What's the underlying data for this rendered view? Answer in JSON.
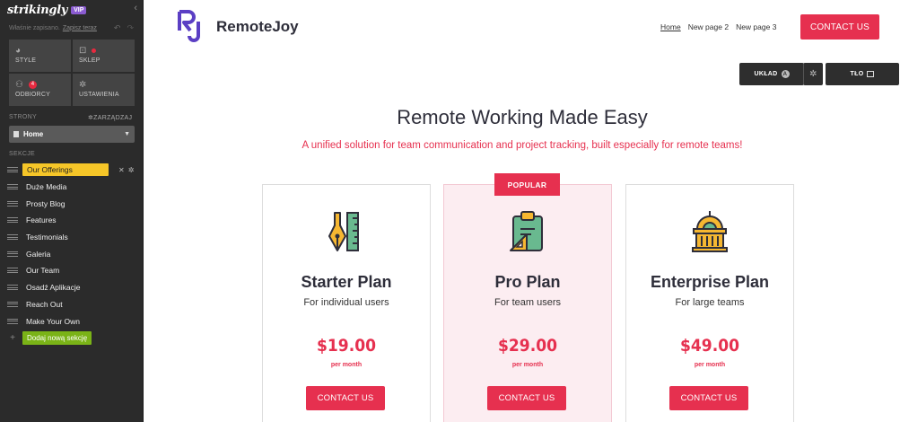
{
  "sidebar": {
    "brand": "strikingly",
    "vip": "VIP",
    "saved_text": "Właśnie zapisano.",
    "save_now": "Zapisz teraz",
    "tiles": [
      {
        "label": "STYLE",
        "icon": "palette-icon"
      },
      {
        "label": "SKLEP",
        "icon": "shopping-bag-icon"
      },
      {
        "label": "ODBIORCY",
        "icon": "users-icon",
        "badge": "4"
      },
      {
        "label": "USTAWIENIA",
        "icon": "gear-icon"
      }
    ],
    "pages_label": "STRONY",
    "manage_label": "ZARZĄDZAJ",
    "current_page": "Home",
    "sections_label": "SEKCJE",
    "sections": [
      "Our Offerings",
      "Duże Media",
      "Prosty Blog",
      "Features",
      "Testimonials",
      "Galeria",
      "Our Team",
      "Osadź Aplikacje",
      "Reach Out",
      "Make Your Own"
    ],
    "add_section": "Dodaj nową sekcję"
  },
  "site": {
    "name": "RemoteJoy",
    "nav": [
      "Home",
      "New page 2",
      "New page 3"
    ],
    "contact": "CONTACT US"
  },
  "controls": {
    "layout": "UKŁAD",
    "layout_badge": "A",
    "background": "TŁO"
  },
  "hero": {
    "title": "Remote Working Made Easy",
    "subtitle": "A unified solution for team communication and project tracking, built especially for remote teams!"
  },
  "popular_label": "POPULAR",
  "plans": [
    {
      "title": "Starter Plan",
      "sub": "For individual users",
      "price": "$19.00",
      "per": "per month",
      "button": "CONTACT US",
      "icon": "design-tools-icon"
    },
    {
      "title": "Pro Plan",
      "sub": "For team users",
      "price": "$29.00",
      "per": "per month",
      "button": "CONTACT US",
      "icon": "clipboard-icon"
    },
    {
      "title": "Enterprise Plan",
      "sub": "For large teams",
      "price": "$49.00",
      "per": "per month",
      "button": "CONTACT US",
      "icon": "building-icon"
    }
  ],
  "colors": {
    "accent": "#e6304f",
    "sidebar_bg": "#2b2b2b",
    "active_section": "#f6c628",
    "add_button": "#7ab317",
    "vip": "#8a5bd0",
    "logo": "#5b3fc4"
  }
}
